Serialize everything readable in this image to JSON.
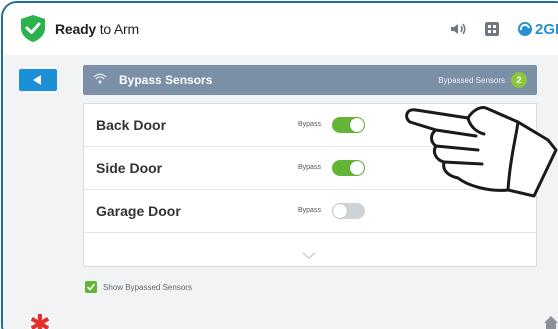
{
  "status": {
    "state_bold": "Ready",
    "state_rest": " to Arm"
  },
  "status_icons": [
    "moon-icon",
    "volume-icon",
    "keypad-icon"
  ],
  "brand": {
    "label": "2GI"
  },
  "panel": {
    "title": "Bypass Sensors",
    "bypassed_label": "Bypassed Sensors",
    "bypassed_count": "2"
  },
  "sensors": [
    {
      "name": "Back Door",
      "bypass_label": "Bypass",
      "bypassed": true
    },
    {
      "name": "Side Door",
      "bypass_label": "Bypass",
      "bypassed": true
    },
    {
      "name": "Garage Door",
      "bypass_label": "Bypass",
      "bypassed": false
    }
  ],
  "show_bypassed": {
    "label": "Show Bypassed Sensors",
    "checked": true
  },
  "colors": {
    "accent": "#1d8fd6",
    "toggle_on": "#63b535",
    "header": "#7b8fa6",
    "emergency": "#e3302f",
    "shield": "#2bb24c"
  }
}
